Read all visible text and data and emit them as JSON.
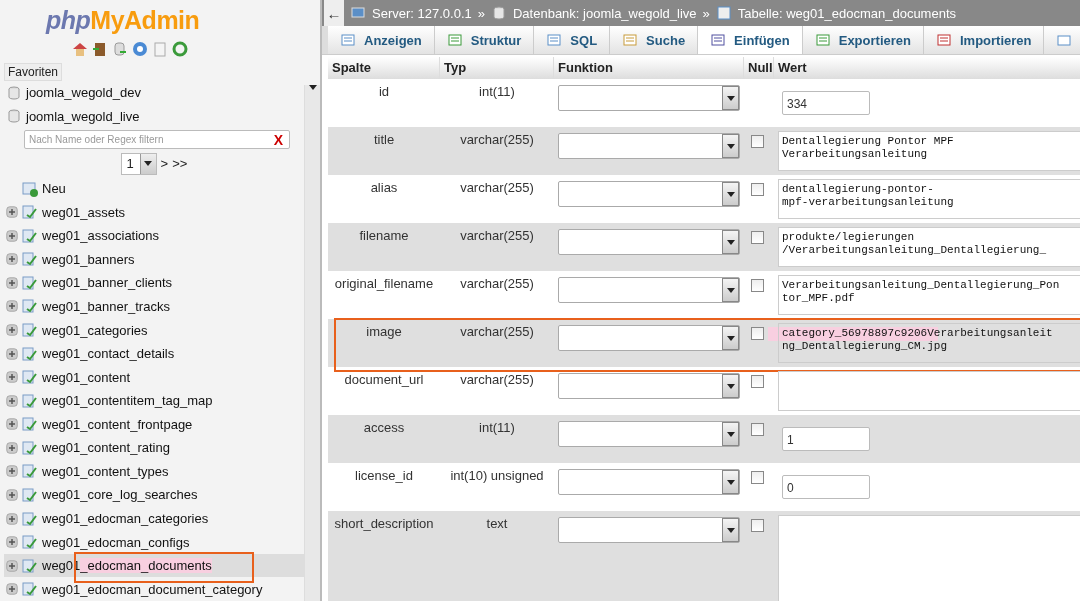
{
  "sidebar": {
    "logo": {
      "part_1": "php",
      "part_2": "MyAdmin"
    },
    "favorites_label": "Favoriten",
    "databases": [
      {
        "name": "joomla_wegold_dev"
      },
      {
        "name": "joomla_wegold_live",
        "children": {
          "filter": {
            "placeholder": "Nach Name oder Regex filtern",
            "clear": "X"
          },
          "pager": {
            "page": "1",
            "next": ">",
            "last": ">>"
          },
          "new_label": "Neu",
          "tables": [
            {
              "name": "weg01_assets",
              "selected": false
            },
            {
              "name": "weg01_associations",
              "selected": false
            },
            {
              "name": "weg01_banners",
              "selected": false
            },
            {
              "name": "weg01_banner_clients",
              "selected": false
            },
            {
              "name": "weg01_banner_tracks",
              "selected": false
            },
            {
              "name": "weg01_categories",
              "selected": false
            },
            {
              "name": "weg01_contact_details",
              "selected": false
            },
            {
              "name": "weg01_content",
              "selected": false
            },
            {
              "name": "weg01_contentitem_tag_map",
              "selected": false
            },
            {
              "name": "weg01_content_frontpage",
              "selected": false
            },
            {
              "name": "weg01_content_rating",
              "selected": false
            },
            {
              "name": "weg01_content_types",
              "selected": false
            },
            {
              "name": "weg01_core_log_searches",
              "selected": false
            },
            {
              "name": "weg01_edocman_categories",
              "selected": false
            },
            {
              "name": "weg01_edocman_configs",
              "selected": false
            },
            {
              "name": "weg01_edocman_documents",
              "selected": true
            },
            {
              "name": "weg01_edocman_document_category",
              "selected": false
            }
          ]
        }
      }
    ]
  },
  "breadcrumb": {
    "back": "←",
    "server": "Server: 127.0.0.1",
    "database": "Datenbank: joomla_wegold_live",
    "table": "Tabelle: weg01_edocman_documents",
    "separator": "»"
  },
  "tabs": [
    {
      "label": "Anzeigen",
      "selected": false
    },
    {
      "label": "Struktur",
      "selected": false
    },
    {
      "label": "SQL",
      "selected": false
    },
    {
      "label": "Suche",
      "selected": false
    },
    {
      "label": "Einfügen",
      "selected": true
    },
    {
      "label": "Exportieren",
      "selected": false
    },
    {
      "label": "Importieren",
      "selected": false
    }
  ],
  "table": {
    "columns": [
      "Spalte",
      "Typ",
      "Funktion",
      "Null",
      "Wert"
    ],
    "rows": [
      {
        "column": "id",
        "type": "int(11)",
        "nullable": false,
        "kind": "input",
        "value": "334",
        "annotated": false
      },
      {
        "column": "title",
        "type": "varchar(255)",
        "nullable": true,
        "null_checked": false,
        "kind": "textarea",
        "lines": [
          "Dentallegierung Pontor MPF",
          "Verarbeitungsanleitung"
        ],
        "annotated": false
      },
      {
        "column": "alias",
        "type": "varchar(255)",
        "nullable": true,
        "null_checked": false,
        "kind": "textarea",
        "lines": [
          "dentallegierung-pontor-",
          "mpf-verarbeitungsanleitung"
        ],
        "annotated": false
      },
      {
        "column": "filename",
        "type": "varchar(255)",
        "nullable": true,
        "null_checked": false,
        "kind": "textarea",
        "lines": [
          "produkte/legierungen",
          "/Verarbeitungsanleitung_Dentallegierung_"
        ],
        "annotated": false
      },
      {
        "column": "original_filename",
        "type": "varchar(255)",
        "nullable": true,
        "null_checked": false,
        "kind": "textarea",
        "lines": [
          "Verarbeitungsanleitung_Dentallegierung_Pon",
          "tor_MPF.pdf"
        ],
        "annotated": false
      },
      {
        "column": "image",
        "type": "varchar(255)",
        "nullable": true,
        "null_checked": false,
        "kind": "textarea",
        "lines": [
          "category_56978897c9206Verarbeitungsanleit",
          "ng_Dentallegierung_CM.jpg"
        ],
        "annotated": true
      },
      {
        "column": "document_url",
        "type": "varchar(255)",
        "nullable": true,
        "null_checked": false,
        "kind": "textarea",
        "lines": [],
        "annotated": false
      },
      {
        "column": "access",
        "type": "int(11)",
        "nullable": true,
        "null_checked": false,
        "kind": "input",
        "value": "1",
        "annotated": false
      },
      {
        "column": "license_id",
        "type": "int(10) unsigned",
        "nullable": true,
        "null_checked": false,
        "kind": "input",
        "value": "0",
        "annotated": false
      },
      {
        "column": "short_description",
        "type": "text",
        "nullable": true,
        "null_checked": false,
        "kind": "bigtext",
        "annotated": false
      }
    ]
  }
}
